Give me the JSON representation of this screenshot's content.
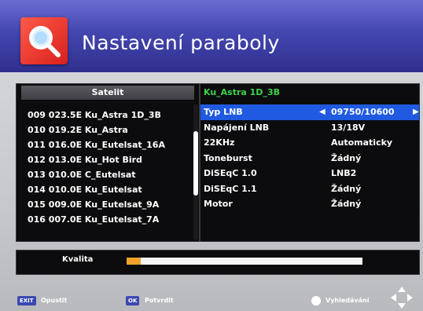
{
  "header": {
    "title": "Nastavení paraboly",
    "icon": "search-icon"
  },
  "satellite_panel": {
    "title": "Satelit",
    "items": [
      "009 023.5E Ku_Astra 1D_3B",
      "010 019.2E Ku_Astra",
      "011 016.0E Ku_Eutelsat_16A",
      "012 013.0E Ku_Hot Bird",
      "013 010.0E C_Eutelsat",
      "014 010.0E Ku_Eutelsat",
      "015 009.0E Ku_Eutelsat_9A",
      "016 007.0E Ku_Eutelsat_7A"
    ]
  },
  "settings_panel": {
    "title": "Ku_Astra 1D_3B",
    "rows": [
      {
        "label": "Typ LNB",
        "value": "09750/10600",
        "selected": true
      },
      {
        "label": "Napájení LNB",
        "value": "13/18V"
      },
      {
        "label": "22KHz",
        "value": "Automaticky"
      },
      {
        "label": "Toneburst",
        "value": "Žádný"
      },
      {
        "label": "DiSEqC 1.0",
        "value": "LNB2"
      },
      {
        "label": "DiSEqC 1.1",
        "value": "Žádný"
      },
      {
        "label": "Motor",
        "value": "Žádný"
      }
    ]
  },
  "quality": {
    "label": "Kvalita",
    "level": 0.06,
    "fill_color": "#f0a22a"
  },
  "footer": {
    "exit_key": "EXIT",
    "exit_label": "Opustit",
    "ok_key": "OK",
    "ok_label": "Potvrdit",
    "search_label": "Vyhledávání",
    "nav_icon": "dpad-icon"
  },
  "colors": {
    "accent": "#1f5ae0",
    "header_text_green": "#3fd24a",
    "header_bg": "#4446b0"
  }
}
